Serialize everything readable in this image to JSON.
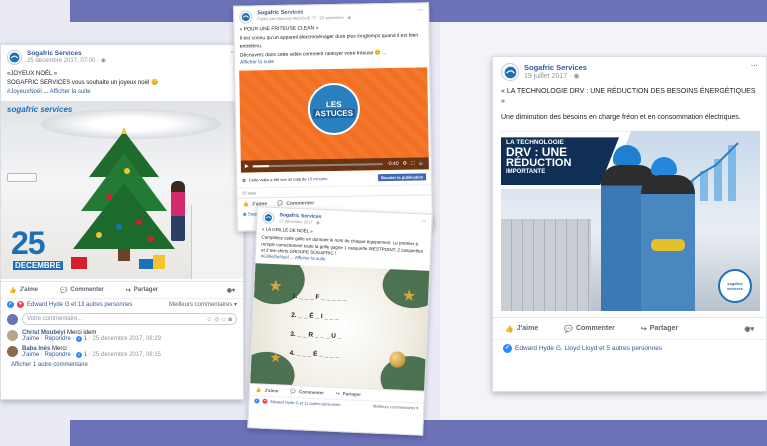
{
  "colors": {
    "fb_blue": "#365899",
    "band": "#6c72b8",
    "astuces_orange": "#f36f21"
  },
  "post1": {
    "page_name": "Sogafric Services",
    "date": "25 décembre 2017, 07:00 · ",
    "title": "«JOYEUX NOËL »",
    "text": "SOGAFRIC SERVICES vous souhaite un joyeux noël 😊",
    "hashtag": "#JoyeuxNoël",
    "hashtag_sep": " ... ",
    "see_more": "Afficher la suite",
    "brand": "sogafric services",
    "day": "25",
    "month": "DECEMBRE",
    "like": "J'aime",
    "comment": "Commenter",
    "share": "Partager",
    "reactions": "Edward Hyde G et 13 autres personnes",
    "best_comments": "Meilleurs commentaires ▾",
    "comment_placeholder": "Votre commentaire...",
    "comments": [
      {
        "name": "Christ Moubéyi",
        "text": "Merci idem",
        "meta": "J'aime · Répondre · ",
        "likes": "1",
        "date": " · 25 décembre 2017, 08:29"
      },
      {
        "name": "Baba Inès",
        "text": "Merci",
        "meta": "J'aime · Répondre · ",
        "likes": "1",
        "date": " · 25 décembre 2017, 08:15"
      }
    ],
    "show_comment": "Afficher 1 autre commentaire"
  },
  "post2": {
    "page_name": "Sogafric Services",
    "published_by": "Publié par Manuela MENGUE ?? · 22 septembre · ",
    "title": "« POUR UNE FRITEUSE CLEAN »",
    "text1": "Il est connu qu'un appareil électroménager dure plus longtemps quand il est bien entretenu.",
    "text2": "Découvrez dans cette vidéo comment nettoyer votre friteuse 😊 ...",
    "see_more": "Afficher la suite",
    "badge_les": "LES",
    "badge_astuces": "ASTUCES",
    "time": "-0:40",
    "views_prefix": "Cette vidéo a été vue un total de ",
    "views_link": "10 minutes",
    "views_suffix": ".",
    "boost": "Booster la publication",
    "views_count": "27 vues",
    "like": "J'aime",
    "comment": "Commenter",
    "page_small": "Sogafri"
  },
  "post3": {
    "page_name": "Sogafric Services",
    "date": "22 décembre 2017 · ",
    "title": "« LA GRILLE DE NOËL »",
    "text": "Complétez cette grille en donnant le nom de chaque équipement. Le premier à remplir correctement toute la grille gagne 1 casquette WESTPOINT, 2 casquettes et 2 tee-shirts GROUPE SOGAFRIC !",
    "hashtag": "#GrilleDeNoël",
    "hashtag_sep": " ... ",
    "see_more": "Afficher la suite",
    "grid_rows": [
      {
        "num": "1.",
        "pattern": "_ _ _ F _ _ _ _ _"
      },
      {
        "num": "2.",
        "pattern": "_ _ É _ I _ _ _"
      },
      {
        "num": "3.",
        "pattern": "_ _ R _ _ _ U _"
      },
      {
        "num": "4.",
        "pattern": "_ _ _ É _ _ _ _"
      }
    ],
    "like": "J'aime",
    "comment": "Commenter",
    "share": "Partager",
    "reactions": "Edward Hyde G et 11 autres personnes",
    "best_comments": "Meilleurs commentaires ▾"
  },
  "post4": {
    "page_name": "Sogafric Services",
    "date": "19 juillet 2017 · ",
    "title": "« LA TECHNOLOGIE DRV : UNE RÉDUCTION DES BESOINS ÉNERGÉTIQUES »",
    "text": "Une diminution des besoins en charge fréon et en consommation électriques.",
    "banner_line1": "LA TECHNOLOGIE",
    "banner_line2": "DRV : UNE",
    "banner_line3": "RÉDUCTION",
    "banner_line4": "IMPORTANTE",
    "logo_text": "sogafric services",
    "like": "J'aime",
    "comment": "Commenter",
    "share": "Partager",
    "reactions": "Edward Hyde G, Lloyd Lloyd et 5 autres personnes"
  }
}
